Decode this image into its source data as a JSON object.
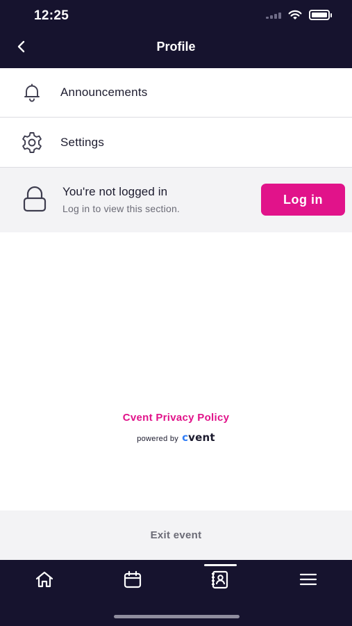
{
  "status_bar": {
    "time": "12:25"
  },
  "header": {
    "title": "Profile",
    "back_icon": "chevron-left-icon"
  },
  "menu": {
    "items": [
      {
        "label": "Announcements",
        "icon": "bell-icon"
      },
      {
        "label": "Settings",
        "icon": "gear-icon"
      }
    ]
  },
  "login_prompt": {
    "title": "You're not logged in",
    "subtitle": "Log in to view this section.",
    "button_label": "Log in",
    "icon": "lock-icon"
  },
  "footer": {
    "privacy_link": "Cvent Privacy Policy",
    "powered_by": "powered by",
    "brand_c": "c",
    "brand_rest": "vent"
  },
  "exit_event": {
    "label": "Exit event"
  },
  "tab_bar": {
    "items": [
      {
        "icon": "home-icon",
        "selected": false
      },
      {
        "icon": "calendar-icon",
        "selected": false
      },
      {
        "icon": "profile-badge-icon",
        "selected": true
      },
      {
        "icon": "menu-icon",
        "selected": false
      }
    ]
  },
  "colors": {
    "header_bg": "#16132e",
    "accent": "#e1138a",
    "panel_bg": "#f3f3f5",
    "text": "#1c1b2e",
    "muted": "#6b6b76"
  }
}
